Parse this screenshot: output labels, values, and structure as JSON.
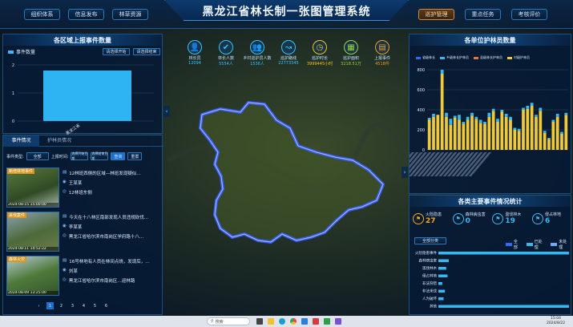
{
  "title": "黑龙江省林长制一张图管理系统",
  "nav_left": [
    "组织体系",
    "信息发布",
    "林草资源"
  ],
  "nav_right": [
    "巡护管理",
    "重点任务",
    "考核评价"
  ],
  "stats": [
    {
      "label": "林长员",
      "value": "12094",
      "icon": "user-icon",
      "color": "#34c3ff"
    },
    {
      "label": "林长人数",
      "value": "5554人",
      "icon": "user-check-icon",
      "color": "#34c3ff"
    },
    {
      "label": "乡村巡护员人数",
      "value": "1536人",
      "icon": "users-icon",
      "color": "#34c3ff"
    },
    {
      "label": "巡护路线",
      "value": "22773345",
      "icon": "route-icon",
      "color": "#34c3ff"
    },
    {
      "label": "巡护时长",
      "value": "3999445小时",
      "icon": "clock-icon",
      "color": "#f3c316"
    },
    {
      "label": "巡护面积",
      "value": "3218.51万",
      "icon": "area-icon",
      "color": "#9ad43a"
    },
    {
      "label": "上报事件",
      "value": "4518件",
      "icon": "report-icon",
      "color": "#f39a1e"
    }
  ],
  "left_chart": {
    "title": "各区域上报事件数量",
    "legend": "事件数量",
    "select1": "请选择开始",
    "select2": "请选择结束",
    "y_ticks": [
      "2",
      "1",
      "0"
    ],
    "x_label": "黑龙江省",
    "chart_data": {
      "type": "bar",
      "categories": [
        "黑龙江省"
      ],
      "values": [
        1.8
      ],
      "ylim": [
        0,
        2
      ]
    }
  },
  "events": {
    "tab1": "事件情况",
    "tab2": "护林员情况",
    "filter_label1": "事件类型:",
    "filter_value1": "全部",
    "filter_label2": "上报时间:",
    "date1": "选择开始日期",
    "date2": "选择结束日期",
    "query": "查询",
    "reset": "重置",
    "items": [
      {
        "tag": "新增林地事件",
        "time": "2024-08-15 15:00:00",
        "line1": "12林班西侧的区域—林班发现疑似…",
        "line2": "王某某",
        "line3": "12林班东侧",
        "img": "forest"
      },
      {
        "tag": "采伐案件",
        "time": "2024-08-11 14:52:22",
        "line1": "今天在十八林区南部发现人员违规砍伐…",
        "line2": "李某某",
        "line3": "黑龙江省哈尔滨市南岗区学府路十八…",
        "img": "trees"
      },
      {
        "tag": "森林火灾",
        "time": "2024-08-09 13:25:00",
        "line1": "16号林地有人员在林间点烧，发现后，…",
        "line2": "刘某",
        "line3": "黑龙江省哈尔滨市南岗区…迎林路",
        "img": "field"
      }
    ],
    "pages": [
      "‹",
      "1",
      "2",
      "3",
      "4",
      "5",
      "6"
    ]
  },
  "right_chart": {
    "title": "各单位护林员数量",
    "legend": [
      "省级林长",
      "乡级林长护林员",
      "县级林长护林员",
      "村级护林员"
    ],
    "legend_colors": [
      "#2f6bff",
      "#35b9f0",
      "#e47a2e",
      "#f0c93a"
    ],
    "y_ticks": [
      "800",
      "600",
      "400",
      "200",
      "0"
    ],
    "chart_data": {
      "type": "bar",
      "series": [
        {
          "name": "村级护林员",
          "values": [
            300,
            330,
            350,
            760,
            330,
            250,
            320,
            300,
            260,
            300,
            340,
            310,
            270,
            260,
            330,
            390,
            280,
            380,
            330,
            300,
            200,
            190,
            400,
            410,
            440,
            330,
            390,
            170,
            110,
            280,
            330,
            160,
            350
          ]
        },
        {
          "name": "乡级林长护林员",
          "values": [
            20,
            30,
            0,
            40,
            40,
            60,
            20,
            50,
            20,
            30,
            30,
            20,
            30,
            20,
            40,
            20,
            30,
            20,
            30,
            30,
            20,
            20,
            20,
            30,
            30,
            20,
            30,
            20,
            10,
            20,
            30,
            20,
            20
          ]
        }
      ],
      "ylim": [
        0,
        800
      ]
    }
  },
  "events_stats": {
    "title": "各类主要事件情况统计",
    "cards": [
      {
        "label": "火险隐患",
        "value": "27",
        "color": "#f5a623"
      },
      {
        "label": "森林病虫害",
        "value": "0",
        "color": "#35b9f0"
      },
      {
        "label": "滥伐林木",
        "value": "19",
        "color": "#35b9f0"
      },
      {
        "label": "侵占林地",
        "value": "6",
        "color": "#35b9f0"
      }
    ],
    "select": "全部分类",
    "legend": [
      "全部",
      "已处理",
      "未处理"
    ],
    "rows": [
      {
        "label": "火险隐患事件",
        "value": 100
      },
      {
        "label": "森林病虫害",
        "value": 8
      },
      {
        "label": "滥伐林木",
        "value": 6
      },
      {
        "label": "侵占林地",
        "value": 7
      },
      {
        "label": "非法狩猎",
        "value": 3
      },
      {
        "label": "非法采伐",
        "value": 5
      },
      {
        "label": "人为破坏",
        "value": 4
      },
      {
        "label": "其他",
        "value": 100
      }
    ]
  },
  "taskbar": {
    "search": "搜索",
    "time": "15:04",
    "date": "2024/8/22"
  }
}
